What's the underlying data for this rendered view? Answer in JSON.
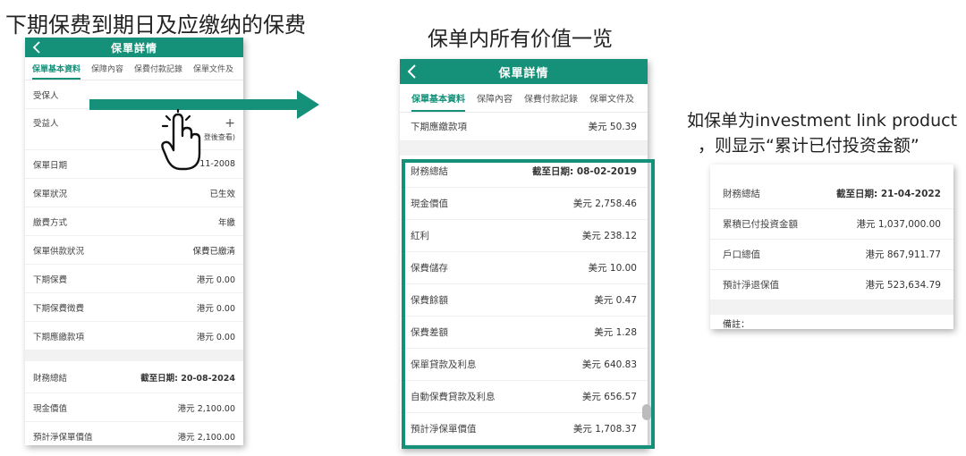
{
  "captions": {
    "left": "下期保费到期日及应缴纳的保费",
    "middle": "保单内所有价值一览",
    "right_line1": "如保单为investment link product",
    "right_line2": "，则显示“累计已付投资金额”"
  },
  "phone_left": {
    "title": "保單詳情",
    "tabs": [
      "保單基本資料",
      "保障內容",
      "保費付款記錄",
      "保單文件及"
    ],
    "rows": [
      {
        "label": "受保人",
        "value": ""
      },
      {
        "label": "受益人",
        "value": "+"
      },
      {
        "label": "",
        "value": "登後查看)"
      },
      {
        "label": "保單日期",
        "value": "11-2008"
      },
      {
        "label": "保單狀況",
        "value": "已生效"
      },
      {
        "label": "繳費方式",
        "value": "年繳"
      },
      {
        "label": "保單供款狀況",
        "value": "保費已繳清"
      },
      {
        "label": "下期保費",
        "value": "港元 0.00"
      },
      {
        "label": "下期保費徵費",
        "value": "港元 0.00"
      },
      {
        "label": "下期應繳款項",
        "value": "港元 0.00"
      }
    ],
    "summary": {
      "label": "財務總結",
      "value": "截至日期: 20-08-2024"
    },
    "rows2": [
      {
        "label": "現金價值",
        "value": "港元 2,100.00"
      },
      {
        "label": "預計淨保單價值",
        "value": "港元 2,100.00"
      }
    ]
  },
  "phone_mid": {
    "title": "保單詳情",
    "tabs": [
      "保單基本資料",
      "保障內容",
      "保費付款記錄",
      "保單文件及"
    ],
    "top_row": {
      "label": "下期應繳款項",
      "value": "美元 50.39"
    },
    "summary": {
      "label": "財務總結",
      "value": "截至日期: 08-02-2019"
    },
    "rows": [
      {
        "label": "現金價值",
        "value": "美元 2,758.46"
      },
      {
        "label": "紅利",
        "value": "美元 238.12"
      },
      {
        "label": "保費儲存",
        "value": "美元 10.00"
      },
      {
        "label": "保費餘額",
        "value": "美元 0.47"
      },
      {
        "label": "保費差額",
        "value": "美元 1.28"
      },
      {
        "label": "保單貸款及利息",
        "value": "美元 640.83"
      },
      {
        "label": "自動保費貸款及利息",
        "value": "美元 656.57"
      },
      {
        "label": "預計淨保單價值",
        "value": "美元 1,708.37"
      }
    ]
  },
  "panel_right": {
    "summary": {
      "label": "財務總結",
      "value": "截至日期: 21-04-2022"
    },
    "rows": [
      {
        "label": "累積已付投資金額",
        "value": "港元 1,037,000.00"
      },
      {
        "label": "戶口總值",
        "value": "港元 867,911.77"
      },
      {
        "label": "預計淨退保值",
        "value": "港元 523,634.79"
      }
    ],
    "cut_text": "備註："
  },
  "colors": {
    "brand": "#15917a"
  }
}
